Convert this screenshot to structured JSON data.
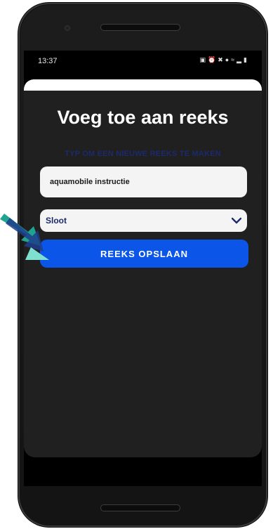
{
  "status_bar": {
    "time": "13:37",
    "icons": [
      "notification-icon",
      "alarm-icon",
      "mute-icon",
      "location-icon",
      "wifi-icon",
      "signal-icon",
      "battery-icon"
    ]
  },
  "dialog": {
    "title": "Voeg toe aan reeks",
    "hint": "TYP OM EEN NIEUWE REEKS TE MAKEN",
    "input_value": "aquamobile instructie",
    "select_value": "Sloot",
    "save_label": "REEKS OPSLAAN"
  },
  "colors": {
    "accent_blue": "#0b56e8",
    "hint_navy": "#1c2a6b",
    "arrow_teal": "#1fa58f",
    "arrow_dark_blue": "#1e3d8c"
  }
}
